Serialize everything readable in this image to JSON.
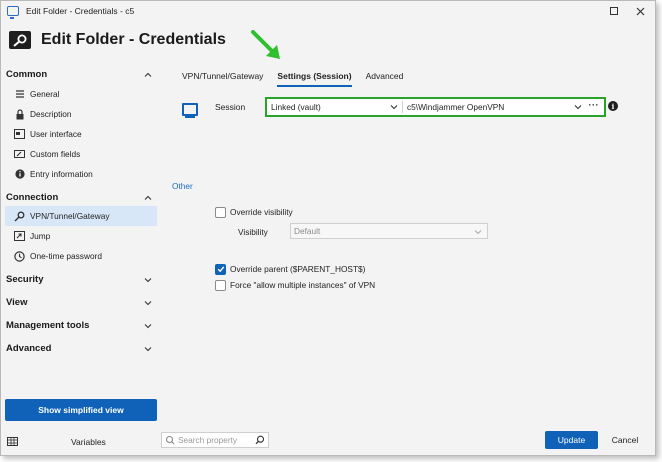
{
  "window": {
    "title": "Edit Folder - Credentials - c5"
  },
  "header": {
    "title": "Edit Folder - Credentials"
  },
  "nav": {
    "sections": [
      {
        "label": "Common",
        "expanded": true
      },
      {
        "label": "Connection",
        "expanded": true
      },
      {
        "label": "Security",
        "expanded": false
      },
      {
        "label": "View",
        "expanded": false
      },
      {
        "label": "Management tools",
        "expanded": false
      },
      {
        "label": "Advanced",
        "expanded": false
      }
    ],
    "common_items": [
      {
        "label": "General",
        "icon": "list-icon"
      },
      {
        "label": "Description",
        "icon": "lock-icon"
      },
      {
        "label": "User interface",
        "icon": "window-icon"
      },
      {
        "label": "Custom fields",
        "icon": "edit-box-icon"
      },
      {
        "label": "Entry information",
        "icon": "info-icon"
      }
    ],
    "connection_items": [
      {
        "label": "VPN/Tunnel/Gateway",
        "icon": "key-icon",
        "selected": true
      },
      {
        "label": "Jump",
        "icon": "jump-icon"
      },
      {
        "label": "One-time password",
        "icon": "clock-icon"
      }
    ],
    "simplified_button": "Show simplified view"
  },
  "tabs": [
    {
      "label": "VPN/Tunnel/Gateway",
      "active": false
    },
    {
      "label": "Settings (Session)",
      "active": true
    },
    {
      "label": "Advanced",
      "active": false
    }
  ],
  "session": {
    "label": "Session",
    "mode_value": "Linked (vault)",
    "entry_value": "c5\\Windjammer OpenVPN",
    "more_label": "···"
  },
  "other": {
    "heading": "Other",
    "override_visibility": {
      "label": "Override visibility",
      "checked": false
    },
    "visibility": {
      "label": "Visibility",
      "value": "Default"
    },
    "override_parent": {
      "label": "Override parent ($PARENT_HOST$)",
      "checked": true
    },
    "force_multiple": {
      "label": "Force \"allow multiple instances\" of VPN",
      "checked": false
    }
  },
  "footer": {
    "variables_label": "Variables",
    "search_placeholder": "Search property",
    "update_label": "Update",
    "cancel_label": "Cancel"
  },
  "colors": {
    "accent": "#0f62b8",
    "highlight_border": "#29a329",
    "arrow": "#2fbf2f",
    "selected_bg": "#d7e7f7",
    "link": "#1a6fc4"
  }
}
